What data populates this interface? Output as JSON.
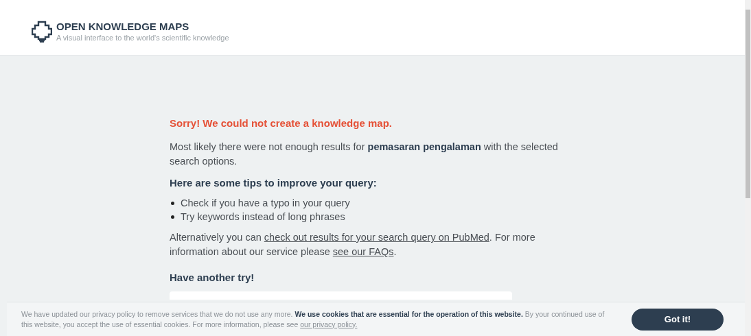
{
  "header": {
    "title": "OPEN KNOWLEDGE MAPS",
    "subtitle": "A visual interface to the world's scientific knowledge"
  },
  "error": {
    "heading": "Sorry! We could not create a knowledge map.",
    "message": "Most likely there were not enough results for **pemasaran pengalaman** with the selected search options.",
    "tips_heading": "Here are some tips to improve your query:",
    "tips": [
      "Check if you have a typo in your query",
      "Try keywords instead of long phrases"
    ],
    "alternative": [
      {
        "kind": "text",
        "text": "Alternatively you can "
      },
      {
        "kind": "link",
        "text": "check out results for your search query on PubMed"
      },
      {
        "kind": "text",
        "text": ". For more information about our service please "
      },
      {
        "kind": "link",
        "text": "see our FAQs"
      },
      {
        "kind": "text",
        "text": "."
      }
    ]
  },
  "retry": {
    "heading": "Have another try!"
  },
  "cookie_banner": {
    "message": "We have updated our privacy policy to remove services that we do not use any more. **We use cookies that are essential for the operation of this website.** By your continued use of this website, you accept the use of essential cookies. For more information, please see",
    "link": "our privacy policy.",
    "button": "Got it!"
  }
}
